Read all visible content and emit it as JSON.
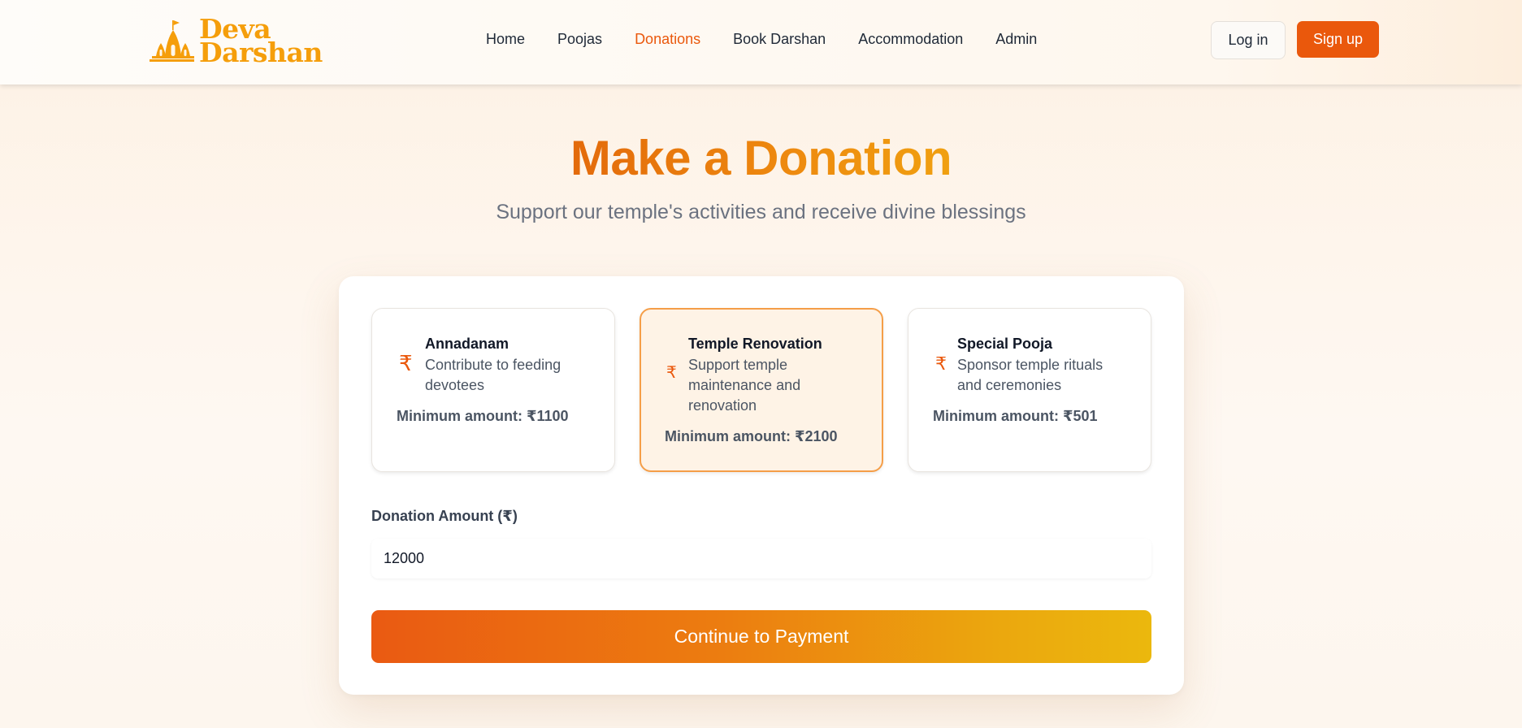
{
  "header": {
    "logo_line1": "Deva",
    "logo_line2": "Darshan",
    "logo_icon": "temple-icon",
    "nav": [
      {
        "label": "Home"
      },
      {
        "label": "Poojas"
      },
      {
        "label": "Donations",
        "active": true
      },
      {
        "label": "Book Darshan"
      },
      {
        "label": "Accommodation"
      },
      {
        "label": "Admin"
      }
    ],
    "login_label": "Log in",
    "signup_label": "Sign up"
  },
  "hero": {
    "title": "Make a Donation",
    "subtitle": "Support our temple's activities and receive divine blessings"
  },
  "donation_types": [
    {
      "icon": "₹",
      "title": "Annadanam",
      "description": "Contribute to feeding devotees",
      "minimum": "Minimum amount: ₹1100",
      "selected": false
    },
    {
      "icon": "₹",
      "title": "Temple Renovation",
      "description": "Support temple maintenance and renovation",
      "minimum": "Minimum amount: ₹2100",
      "selected": true
    },
    {
      "icon": "₹",
      "title": "Special Pooja",
      "description": "Sponsor temple rituals and ceremonies",
      "minimum": "Minimum amount: ₹501",
      "selected": false
    }
  ],
  "form": {
    "amount_label": "Donation Amount (₹)",
    "amount_value": "12000",
    "submit_label": "Continue to Payment"
  },
  "colors": {
    "accent": "#ea580c",
    "logo": "#f59e0b",
    "selected_bg": "#fef3e6",
    "selected_border": "#f59e48"
  }
}
